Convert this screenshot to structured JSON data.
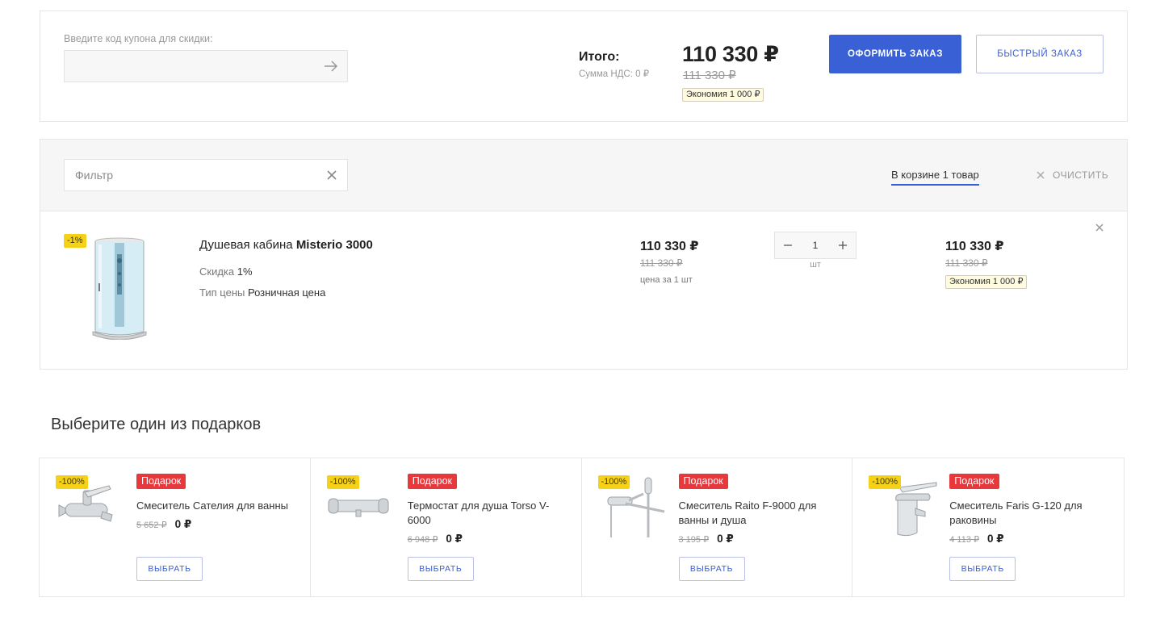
{
  "summary": {
    "coupon_label": "Введите код купона для скидки:",
    "coupon_value": "",
    "total_label": "Итого:",
    "vat_label": "Сумма НДС: 0 ₽",
    "total_price": "110 330 ₽",
    "total_old_price": "111 330 ₽",
    "savings": "Экономия 1 000 ₽",
    "checkout_label": "ОФОРМИТЬ ЗАКАЗ",
    "quick_order_label": "БЫСТРЫЙ ЗАКАЗ"
  },
  "cart": {
    "filter_placeholder": "Фильтр",
    "count_label": "В корзине 1 товар",
    "clear_label": "ОЧИСТИТЬ",
    "items": [
      {
        "discount": "-1%",
        "name_prefix": "Душевая кабина",
        "name_model": "Misterio 3000",
        "discount_label": "Скидка",
        "discount_value": "1%",
        "price_type_label": "Тип цены",
        "price_type_value": "Розничная цена",
        "unit_price": "110 330 ₽",
        "unit_old_price": "111 330 ₽",
        "unit_note": "цена за 1 шт",
        "quantity": "1",
        "quantity_unit": "шт",
        "sum_price": "110 330 ₽",
        "sum_old_price": "111 330 ₽",
        "savings": "Экономия 1 000 ₽"
      }
    ]
  },
  "gifts": {
    "title": "Выберите один из подарков",
    "items": [
      {
        "discount": "-100%",
        "badge": "Подарок",
        "name": "Смеситель Сателия для ванны",
        "old_price": "5 652 ₽",
        "price": "0 ₽",
        "select_label": "ВЫБРАТЬ"
      },
      {
        "discount": "-100%",
        "badge": "Подарок",
        "name": "Термостат для душа Torso V-6000",
        "old_price": "6 948 ₽",
        "price": "0 ₽",
        "select_label": "ВЫБРАТЬ"
      },
      {
        "discount": "-100%",
        "badge": "Подарок",
        "name": "Смеситель Raito F-9000 для ванны и душа",
        "old_price": "3 195 ₽",
        "price": "0 ₽",
        "select_label": "ВЫБРАТЬ"
      },
      {
        "discount": "-100%",
        "badge": "Подарок",
        "name": "Смеситель Faris G-120 для раковины",
        "old_price": "4 113 ₽",
        "price": "0 ₽",
        "select_label": "ВЫБРАТЬ"
      }
    ]
  },
  "colors": {
    "accent": "#3a60d6",
    "gift_badge": "#e8383b",
    "discount_tag": "#f5d218",
    "savings_bg": "#fffbe0"
  },
  "icons": {
    "coupon_submit": "arrow-right-icon",
    "filter_clear": "close-icon",
    "clear_cart": "close-icon",
    "remove_item": "close-icon",
    "qty_minus": "minus-icon",
    "qty_plus": "plus-icon"
  }
}
